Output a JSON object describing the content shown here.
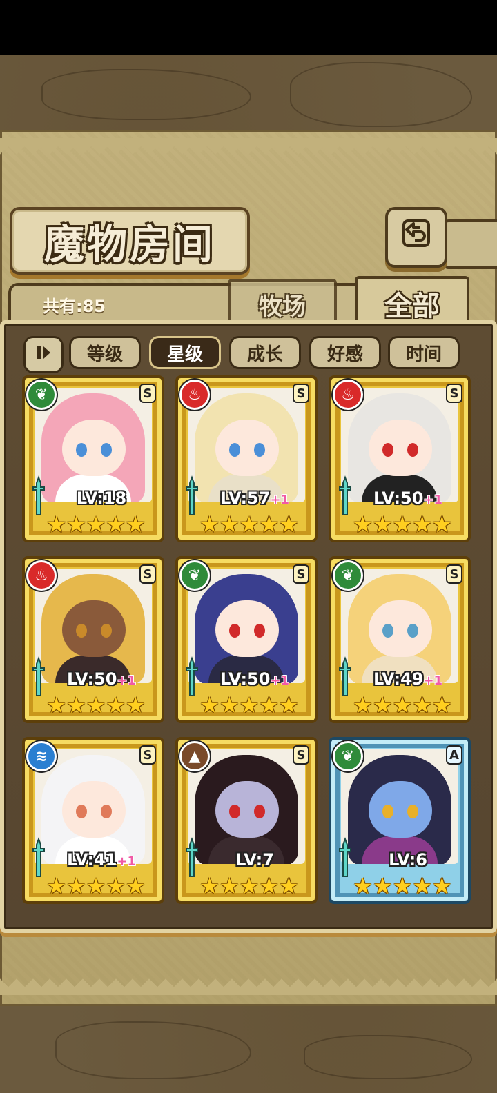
{
  "title": "魔物房间",
  "back_icon": "return-arrow-icon",
  "count_label": "共有:85",
  "tabs": [
    {
      "label": "牧场",
      "active": false
    },
    {
      "label": "全部",
      "active": true
    }
  ],
  "sort_toggle_icon": "pause-sort-icon",
  "sort_buttons": [
    {
      "label": "等级",
      "active": false
    },
    {
      "label": "星级",
      "active": true
    },
    {
      "label": "成长",
      "active": false
    },
    {
      "label": "好感",
      "active": false
    },
    {
      "label": "时间",
      "active": false
    }
  ],
  "colors": {
    "element_grass": "#2f8b3a",
    "element_fire": "#d92a2a",
    "element_water": "#2a7fd1",
    "element_earth": "#7a4a2a",
    "plus_pink": "#f05aa6",
    "star_gold": "#ffcf1f"
  },
  "monsters": [
    {
      "element": "grass",
      "element_icon": "leaf-icon",
      "rank": "S",
      "level": "LV:18",
      "plus": "",
      "stars": 5,
      "hair": "#f4a6b8",
      "skin": "#fde8dc",
      "eyes": "#4a8fd8",
      "outfit": "#ffffff"
    },
    {
      "element": "fire",
      "element_icon": "flame-icon",
      "rank": "S",
      "level": "LV:57",
      "plus": "+1",
      "stars": 5,
      "hair": "#f2e3b0",
      "skin": "#fde8dc",
      "eyes": "#4a8fd8",
      "outfit": "#e9e0c8"
    },
    {
      "element": "fire",
      "element_icon": "flame-icon",
      "rank": "S",
      "level": "LV:50",
      "plus": "+1",
      "stars": 5,
      "hair": "#e8e6e2",
      "skin": "#fde8dc",
      "eyes": "#d12a2a",
      "outfit": "#222222"
    },
    {
      "element": "fire",
      "element_icon": "flame-icon",
      "rank": "S",
      "level": "LV:50",
      "plus": "+1",
      "stars": 5,
      "hair": "#e6b84c",
      "skin": "#8a5a3a",
      "eyes": "#c98a2a",
      "outfit": "#3a2a2a"
    },
    {
      "element": "grass",
      "element_icon": "leaf-icon",
      "rank": "S",
      "level": "LV:50",
      "plus": "+1",
      "stars": 5,
      "hair": "#3a3f8f",
      "skin": "#fde8dc",
      "eyes": "#d12a2a",
      "outfit": "#2a2a44"
    },
    {
      "element": "grass",
      "element_icon": "leaf-icon",
      "rank": "S",
      "level": "LV:49",
      "plus": "+1",
      "stars": 5,
      "hair": "#f5d27a",
      "skin": "#fde8dc",
      "eyes": "#5aa0c8",
      "outfit": "#f0e0c0"
    },
    {
      "element": "water",
      "element_icon": "water-waves-icon",
      "rank": "S",
      "level": "LV:41",
      "plus": "+1",
      "stars": 5,
      "hair": "#f4f4f6",
      "skin": "#fde8dc",
      "eyes": "#e07a5a",
      "outfit": "#ffffff"
    },
    {
      "element": "earth",
      "element_icon": "mountain-icon",
      "rank": "S",
      "level": "LV:7",
      "plus": "",
      "stars": 5,
      "hair": "#2a1a1e",
      "skin": "#b8b4d8",
      "eyes": "#d12a2a",
      "outfit": "#3a2a2e"
    },
    {
      "element": "grass",
      "element_icon": "leaf-icon",
      "rank": "A",
      "level": "LV:6",
      "plus": "",
      "stars": 5,
      "hair": "#2a2a4a",
      "skin": "#7fa8e8",
      "eyes": "#e8b02a",
      "outfit": "#8a3a8a"
    }
  ]
}
